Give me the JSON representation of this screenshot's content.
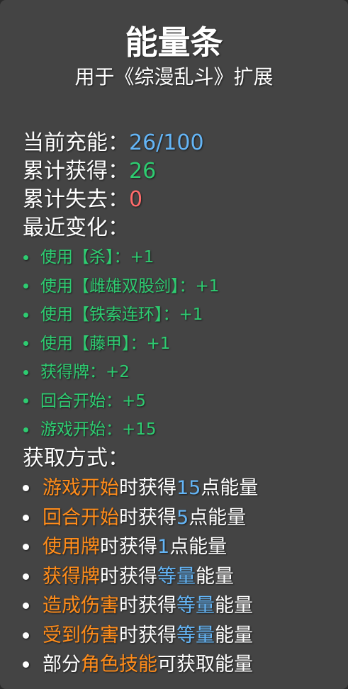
{
  "title": "能量条",
  "subtitle": "用于《综漫乱斗》扩展",
  "stats": {
    "charge_label": "当前充能：",
    "charge_value": "26/100",
    "gained_label": "累计获得：",
    "gained_value": "26",
    "lost_label": "累计失去：",
    "lost_value": "0"
  },
  "recent": {
    "label": "最近变化：",
    "items": [
      "使用【杀】：+1",
      "使用【雌雄双股剑】：+1",
      "使用【铁索连环】：+1",
      "使用【藤甲】：+1",
      "获得牌：+2",
      "回合开始：+5",
      "游戏开始：+15"
    ]
  },
  "methods": {
    "label": "获取方式：",
    "items": [
      {
        "highlight": "游戏开始",
        "text": "时获得",
        "amount": "15",
        "suffix": "点能量"
      },
      {
        "highlight": "回合开始",
        "text": "时获得",
        "amount": "5",
        "suffix": "点能量"
      },
      {
        "highlight": "使用牌",
        "text": "时获得",
        "amount": "1",
        "suffix": "点能量"
      },
      {
        "highlight": "获得牌",
        "text": "时获得",
        "amount": "等量",
        "suffix": "能量"
      },
      {
        "highlight": "造成伤害",
        "text": "时获得",
        "amount": "等量",
        "suffix": "能量"
      },
      {
        "highlight": "受到伤害",
        "text": "时获得",
        "amount": "等量",
        "suffix": "能量"
      }
    ],
    "last": {
      "prefix": "部分",
      "highlight": "角色技能",
      "suffix": "可获取能量"
    }
  },
  "colors": {
    "panel": "#444444",
    "accent_blue": "#64b5f6",
    "accent_green": "#2ecc71",
    "accent_red": "#ff6b6b",
    "accent_orange": "#ff8c1a"
  }
}
